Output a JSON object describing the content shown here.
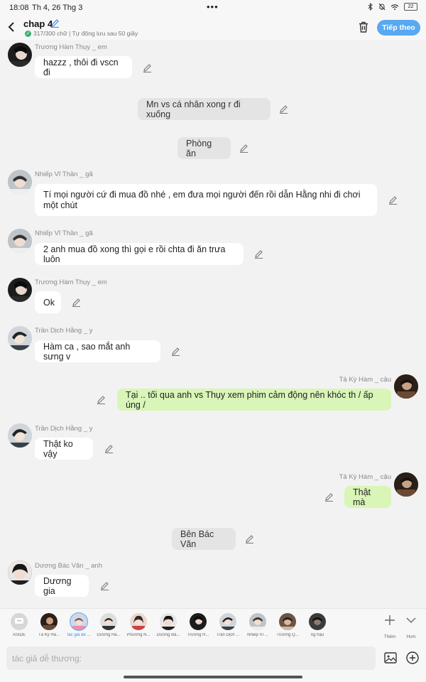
{
  "status": {
    "time": "18:08",
    "date": "Th 4, 26 Thg 3",
    "dots": "•••",
    "battery": "22"
  },
  "header": {
    "title": "chap 4",
    "subtitle": "317/300 chữ | Tự động lưu sau 50 giây",
    "next_label": "Tiếp theo"
  },
  "messages": [
    {
      "name": "Trương Hàm Thụy _ em",
      "text": "hazzz , thôi đi vscn đi"
    },
    {
      "text": "Mn vs cá nhân xong r đi xuống"
    },
    {
      "text": "Phòng ăn"
    },
    {
      "name": "Nhiếp Vĩ Thần _ gã",
      "text": "Tí mọi người cứ đi mua đồ nhé , em đưa mọi người đến rồi dẫn Hằng nhi đi chơi một chút"
    },
    {
      "name": "Nhiếp Vĩ Thần _ gã",
      "text": "2 anh mua đồ xong thì gọi e rồi chta đi ăn trưa luôn"
    },
    {
      "name": "Trương Hàm Thụy _ em",
      "text": "Ok"
    },
    {
      "name": "Trần Dịch Hằng _ y",
      "text": "Hàm ca , sao mắt anh sưng v"
    },
    {
      "name": "Tả Kỳ Hàm _ cậu",
      "text": "Tại .. tối qua anh vs Thụy xem phim cảm động nên khóc th / ấp úng /"
    },
    {
      "name": "Trần Dịch Hằng _ y",
      "text": "Thật ko vậy"
    },
    {
      "name": "Tả Kỳ Hàm _ cậu",
      "text": "Thật mà"
    },
    {
      "text": "Bên Bác Văn"
    },
    {
      "name": "Dương Bác Văn _ anh",
      "text": "Dương gia"
    }
  ],
  "characters": [
    {
      "label": "ASIDE"
    },
    {
      "label": "Tả Kỳ Hà..."
    },
    {
      "label": "tác giả dễ ..."
    },
    {
      "label": "Dương Há..."
    },
    {
      "label": "Phương N..."
    },
    {
      "label": "Dương Bá..."
    },
    {
      "label": "Trương H..."
    },
    {
      "label": "Trần Dịch ..."
    },
    {
      "label": "Nhiếp Vĩ ..."
    },
    {
      "label": "Trương Q..."
    },
    {
      "label": "ng hậu"
    }
  ],
  "side_buttons": {
    "more_label": "Thêm",
    "expand_label": "Hơn"
  },
  "input": {
    "placeholder": "tác giả dễ thương:"
  },
  "colors": {
    "accent": "#58a8f2",
    "green_bubble": "#d9f5b7",
    "center_bubble": "#e4e4e4"
  }
}
